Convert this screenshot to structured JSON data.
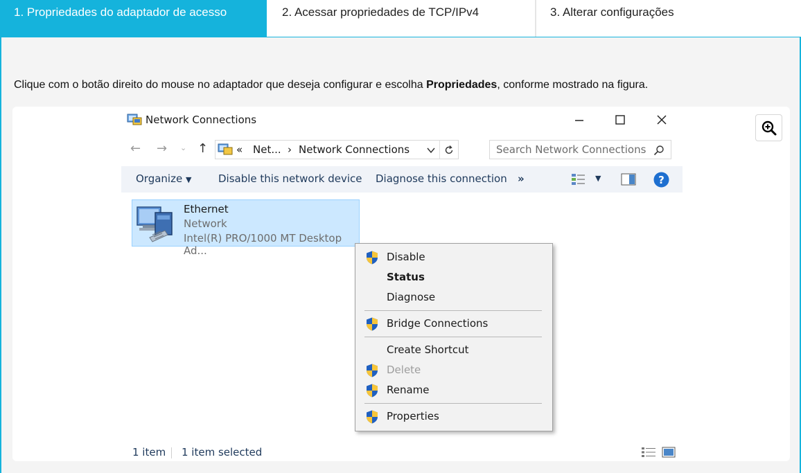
{
  "tabs": [
    {
      "label": "1. Propriedades do adaptador de acesso",
      "active": true
    },
    {
      "label": "2. Acessar propriedades de TCP/IPv4",
      "active": false
    },
    {
      "label": "3. Alterar configurações",
      "active": false
    }
  ],
  "instruction": {
    "before": "Clique com o botão direito do mouse no adaptador que deseja configurar e escolha ",
    "bold": "Propriedades",
    "after": ", conforme mostrado na figura."
  },
  "colors": {
    "accent": "#15b3dc",
    "selection": "#cce8ff",
    "link_blue": "#1e395b"
  },
  "window": {
    "title": "Network Connections",
    "breadcrumb": {
      "prefix": "«",
      "parent": "Net...",
      "separator": "›",
      "current": "Network Connections"
    },
    "search_placeholder": "Search Network Connections",
    "commands": {
      "organize": "Organize",
      "disable": "Disable this network device",
      "diagnose": "Diagnose this connection",
      "more": "»"
    },
    "item": {
      "name": "Ethernet",
      "type": "Network",
      "adapter": "Intel(R) PRO/1000 MT Desktop Ad..."
    },
    "context_menu": {
      "disable": "Disable",
      "status": "Status",
      "diagnose": "Diagnose",
      "bridge": "Bridge Connections",
      "shortcut": "Create Shortcut",
      "delete": "Delete",
      "rename": "Rename",
      "properties": "Properties"
    },
    "status_bar": {
      "count": "1 item",
      "selected": "1 item selected"
    }
  },
  "icons": [
    "magnify-plus-icon",
    "network-connections-icon",
    "minimize-icon",
    "maximize-icon",
    "close-icon",
    "back-arrow-icon",
    "forward-arrow-icon",
    "up-arrow-icon",
    "refresh-icon",
    "search-icon",
    "view-options-icon",
    "preview-pane-icon",
    "help-icon",
    "ethernet-adapter-icon",
    "uac-shield-icon",
    "details-view-icon",
    "large-icons-view-icon"
  ]
}
